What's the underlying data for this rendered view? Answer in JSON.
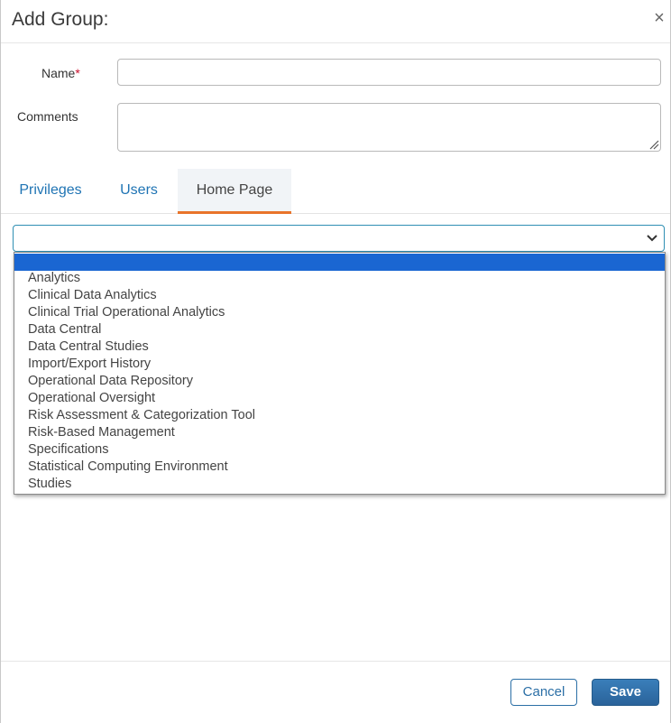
{
  "dialog": {
    "title": "Add Group:",
    "close_label": "×"
  },
  "form": {
    "name_label": "Name",
    "required_marker": "*",
    "name_value": "",
    "comments_label": "Comments",
    "comments_value": ""
  },
  "tabs": [
    {
      "label": "Privileges",
      "active": false
    },
    {
      "label": "Users",
      "active": false
    },
    {
      "label": "Home Page",
      "active": true
    }
  ],
  "home_page_select": {
    "selected_value": "",
    "options": [
      "",
      "Analytics",
      "Clinical Data Analytics",
      "Clinical Trial Operational Analytics",
      "Data Central",
      "Data Central Studies",
      "Import/Export History",
      "Operational Data Repository",
      "Operational Oversight",
      "Risk Assessment & Categorization Tool",
      "Risk-Based Management",
      "Specifications",
      "Statistical Computing Environment",
      "Studies"
    ]
  },
  "footer": {
    "cancel_label": "Cancel",
    "save_label": "Save"
  },
  "colors": {
    "link_blue": "#1f74b4",
    "active_tab_underline": "#e8742a",
    "selected_option": "#1a66d2",
    "save_button": "#2f6fa8",
    "required": "#c8102e"
  }
}
